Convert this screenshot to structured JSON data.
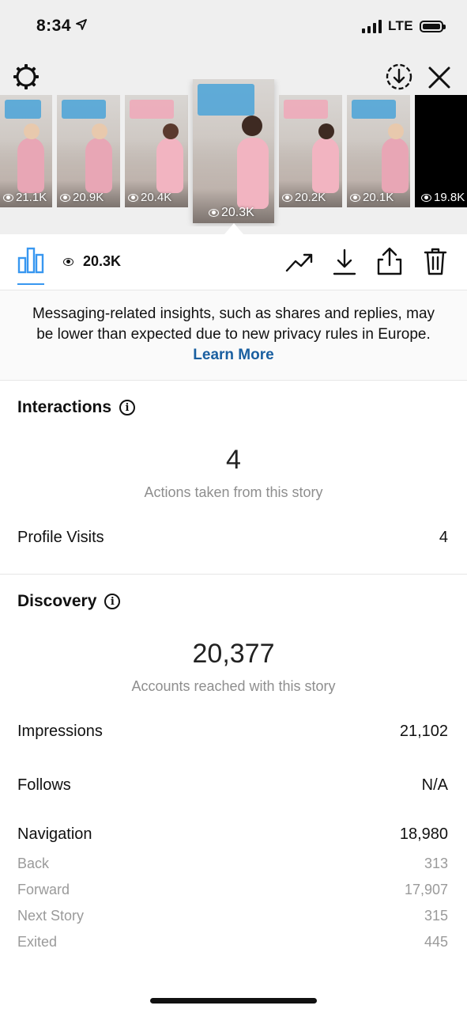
{
  "status_bar": {
    "time": "8:34",
    "network": "LTE"
  },
  "stories": [
    {
      "views": "21.1K",
      "caption_color": "#4aa3d8"
    },
    {
      "views": "20.9K",
      "caption_color": "#4aa3d8"
    },
    {
      "views": "20.4K",
      "caption_color": "#f0a8b8"
    },
    {
      "views": "20.3K",
      "caption_color": "#4aa3d8",
      "selected": true
    },
    {
      "views": "20.2K",
      "caption_color": "#f0a8b8"
    },
    {
      "views": "20.1K",
      "caption_color": "#4aa3d8"
    },
    {
      "views": "19.8K",
      "caption_color": "#000000"
    }
  ],
  "toolbar": {
    "view_count": "20.3K"
  },
  "notice": {
    "text": "Messaging-related insights, such as shares and replies, may be lower than expected due to new privacy rules in Europe.",
    "link": "Learn More"
  },
  "interactions": {
    "title": "Interactions",
    "total": "4",
    "total_label": "Actions taken from this story",
    "rows": [
      {
        "label": "Profile Visits",
        "value": "4"
      }
    ]
  },
  "discovery": {
    "title": "Discovery",
    "total": "20,377",
    "total_label": "Accounts reached with this story",
    "impressions": {
      "label": "Impressions",
      "value": "21,102"
    },
    "follows": {
      "label": "Follows",
      "value": "N/A"
    },
    "navigation": {
      "label": "Navigation",
      "value": "18,980"
    },
    "nav_breakdown": [
      {
        "label": "Back",
        "value": "313"
      },
      {
        "label": "Forward",
        "value": "17,907"
      },
      {
        "label": "Next Story",
        "value": "315"
      },
      {
        "label": "Exited",
        "value": "445"
      }
    ]
  },
  "colors": {
    "accent": "#3897f0",
    "link": "#1a5fa0",
    "secondary_text": "#8e8e8e"
  }
}
